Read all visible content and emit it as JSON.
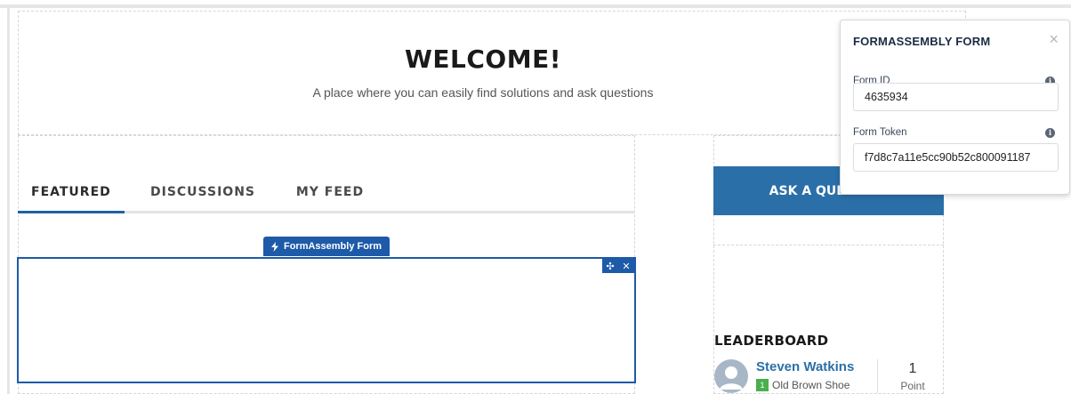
{
  "welcome": {
    "title": "WELCOME!",
    "subtitle": "A place where you can easily find solutions and ask questions"
  },
  "tabs": [
    {
      "label": "FEATURED",
      "active": true
    },
    {
      "label": "DISCUSSIONS",
      "active": false
    },
    {
      "label": "MY FEED",
      "active": false
    }
  ],
  "component": {
    "label": "FormAssembly Form",
    "move_icon": "move-icon",
    "close_icon": "close-icon"
  },
  "ask_button": {
    "label": "ASK A QUESTION"
  },
  "leaderboard": {
    "title": "LEADERBOARD",
    "entries": [
      {
        "name": "Steven Watkins",
        "rank": "1",
        "badge": "Old Brown Shoe",
        "points": "1",
        "points_label": "Point"
      }
    ]
  },
  "panel": {
    "title": "FORMASSEMBLY FORM",
    "close_label": "×",
    "fields": [
      {
        "label": "Form ID",
        "value": "4635934",
        "info": "i"
      },
      {
        "label": "Form Token",
        "value": "f7d8c7a11e5cc90b52c800091187",
        "info": "i"
      }
    ]
  },
  "colors": {
    "accent": "#1d5aa8",
    "button": "#2b6fa8",
    "badge": "#4bae4f"
  }
}
